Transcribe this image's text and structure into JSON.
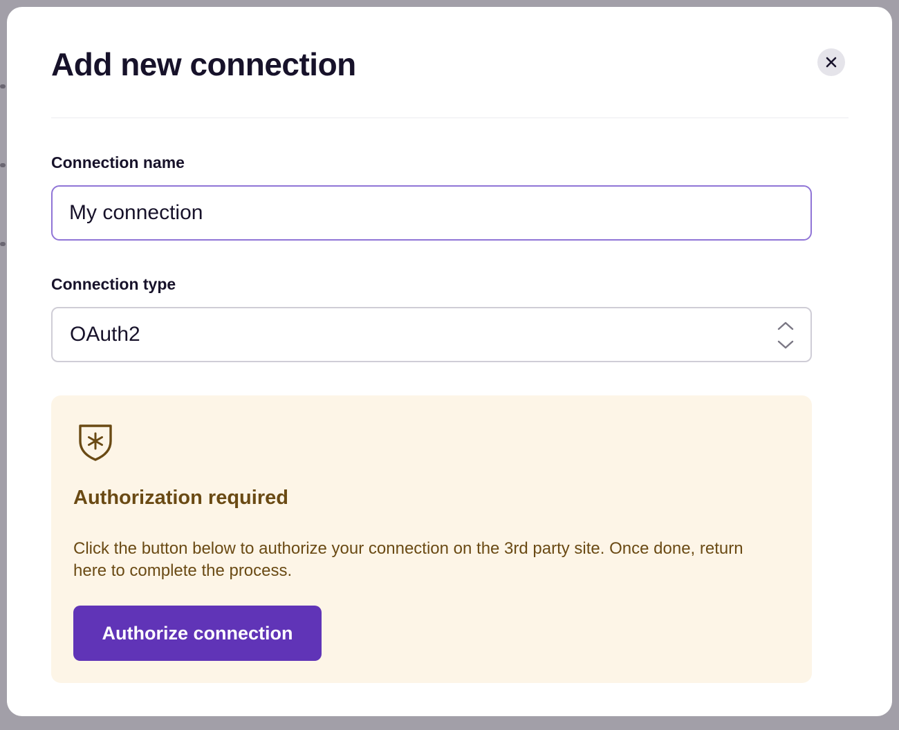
{
  "modal": {
    "title": "Add new connection",
    "close_icon": "close-icon"
  },
  "form": {
    "name_label": "Connection name",
    "name_value": "My connection",
    "type_label": "Connection type",
    "type_value": "OAuth2",
    "type_icon": "chevron-up-down-icon"
  },
  "auth": {
    "icon": "shield-asterisk-icon",
    "title": "Authorization required",
    "body": "Click the button below to authorize your connection on the 3rd party site. Once done, return here to complete the process.",
    "button_label": "Authorize connection"
  },
  "colors": {
    "accent": "#6034b7",
    "focus_border": "#8f74d6",
    "panel_bg": "#fdf5e7",
    "panel_text": "#6a4a14",
    "title_text": "#17122a"
  }
}
